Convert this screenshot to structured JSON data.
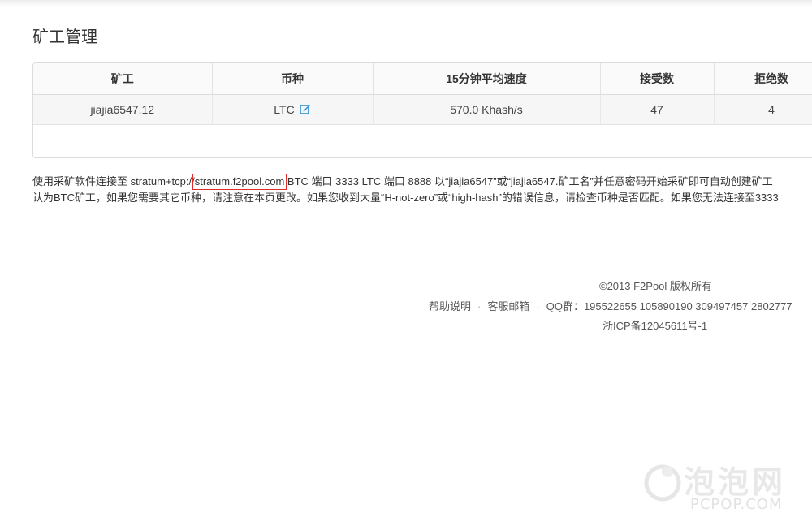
{
  "page": {
    "title": "矿工管理"
  },
  "table": {
    "columns": [
      "矿工",
      "币种",
      "15分钟平均速度",
      "接受数",
      "拒绝数"
    ],
    "rows": [
      {
        "worker": "jiajia6547.12",
        "coin": "LTC",
        "speed": "570.0 Khash/s",
        "accepted": "47",
        "rejected": "4"
      }
    ]
  },
  "notice": {
    "line1_prefix": "使用采矿软件连接至 stratum+tcp://",
    "url": "stratum.f2pool.com",
    "line1_suffix": " BTC 端口 3333 LTC 端口 8888 以“jiajia6547”或“jiajia6547.矿工名”并任意密码开始采矿即可自动创建矿工",
    "line2": "认为BTC矿工，如果您需要其它币种，请注意在本页更改。如果您收到大量“H-not-zero”或“high-hash”的错误信息，请检查币种是否匹配。如果您无法连接至3333"
  },
  "footer": {
    "copyright": "©2013 F2Pool 版权所有",
    "links": {
      "help": "帮助说明",
      "support_email": "客服邮箱",
      "qq": "QQ群：195522655 105890190 309497457 2802777"
    },
    "icp": "浙ICP备12045611号-1"
  },
  "watermark": {
    "name": "泡泡网",
    "domain": "PCPOP.COM"
  }
}
